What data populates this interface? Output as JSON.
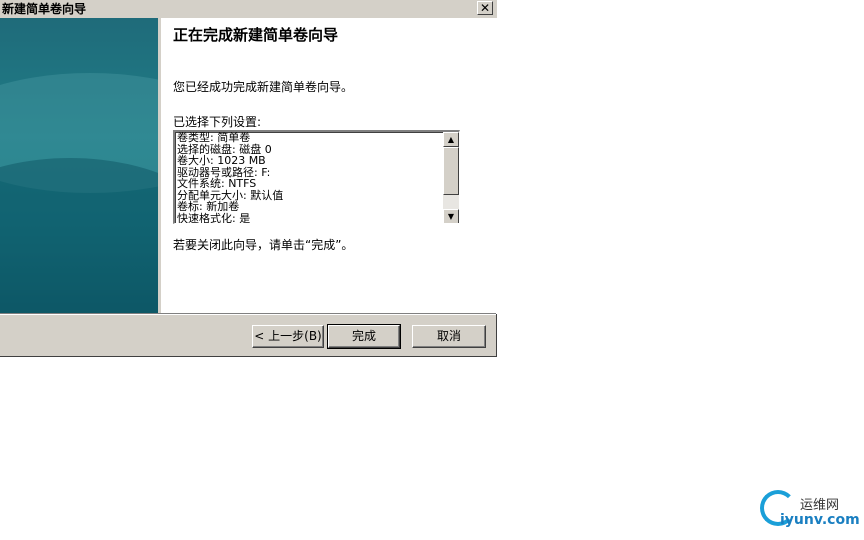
{
  "window": {
    "title": "新建简单卷向导",
    "close_label": "✕"
  },
  "wizard": {
    "heading": "正在完成新建简单卷向导",
    "success_message": "您已经成功完成新建简单卷向导。",
    "settings_label": "已选择下列设置:",
    "settings": [
      "卷类型: 简单卷",
      "选择的磁盘: 磁盘 0",
      "卷大小: 1023 MB",
      "驱动器号或路径: F:",
      "文件系统: NTFS",
      "分配单元大小: 默认值",
      "卷标: 新加卷",
      "快速格式化: 是"
    ],
    "close_hint": "若要关闭此向导，请单击“完成”。"
  },
  "buttons": {
    "back": "< 上一步(B)",
    "finish": "完成",
    "cancel": "取消"
  },
  "scrollbar": {
    "up_arrow": "▲",
    "down_arrow": "▼"
  },
  "watermark": {
    "name": "运维网",
    "domain": "iyunv.com",
    "accent": "#1a9fd8"
  }
}
